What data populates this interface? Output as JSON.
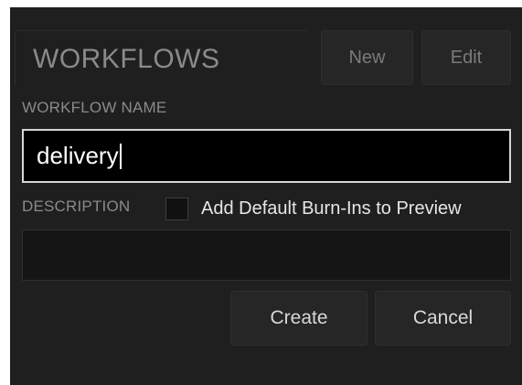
{
  "panel": {
    "title": "WORKFLOWS",
    "new_button": "New",
    "edit_button": "Edit"
  },
  "form": {
    "name_label": "WORKFLOW NAME",
    "name_value": "delivery",
    "description_label": "DESCRIPTION",
    "description_value": "",
    "burnins_checkbox_label": "Add Default Burn-Ins to Preview",
    "burnins_checked": false,
    "create_button": "Create",
    "cancel_button": "Cancel"
  },
  "colors": {
    "background": "#1f1f1f",
    "input_focus_border": "#d6d6d6",
    "label_text": "#8a8a8a"
  }
}
